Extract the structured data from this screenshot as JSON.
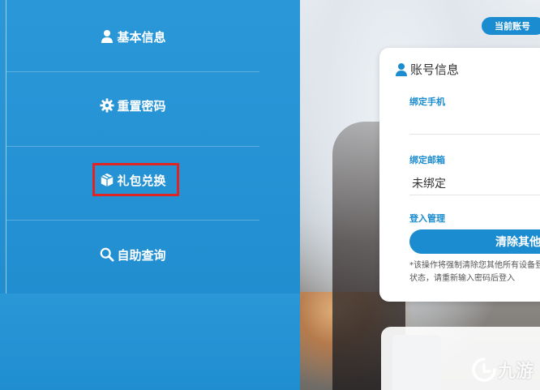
{
  "sidebar": {
    "items": [
      {
        "label": "基本信息",
        "icon": "user-icon"
      },
      {
        "label": "重置密码",
        "icon": "gear-icon"
      },
      {
        "label": "礼包兑换",
        "icon": "package-icon"
      },
      {
        "label": "自助查询",
        "icon": "search-icon"
      }
    ]
  },
  "right": {
    "current_tag": "当前账号",
    "card": {
      "title": "账号信息",
      "fields": [
        {
          "label": "绑定手机",
          "value": ""
        },
        {
          "label": "绑定邮箱",
          "value": "未绑定"
        },
        {
          "label": "登入管理",
          "value": ""
        }
      ],
      "clear_button": "清除其他",
      "note": "*该操作将强制清除您其他所有设备登录状态，请重新输入密码后登入"
    }
  },
  "watermark": "九游",
  "colors": {
    "accent": "#1a8ccf",
    "highlight": "#e02424"
  }
}
